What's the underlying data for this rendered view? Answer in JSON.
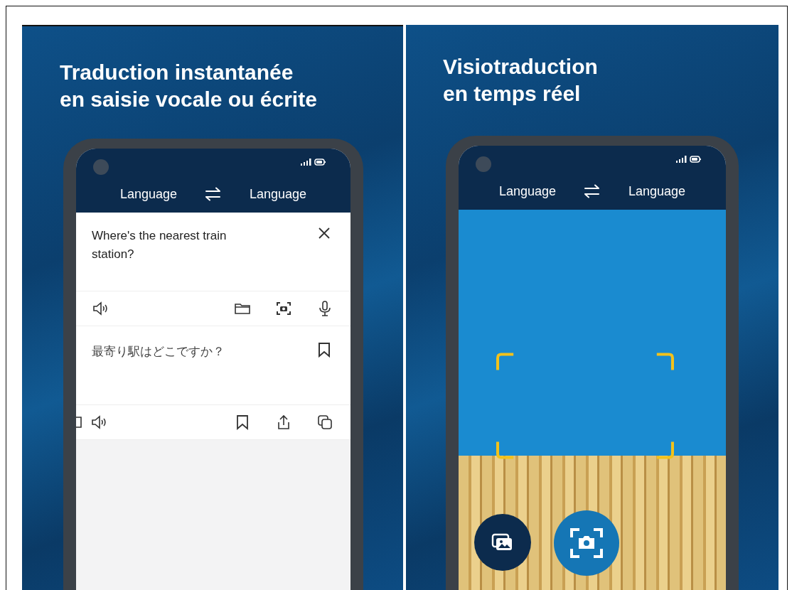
{
  "panels": [
    {
      "kind": "text",
      "headline_lines": [
        "Traduction instantanée",
        "en saisie vocale ou écrite"
      ],
      "phone": {
        "source_language": "Language",
        "target_language": "Language",
        "input_text": "Where's the nearest train station?",
        "output_text": "最寄り駅はどこですか？"
      }
    },
    {
      "kind": "camera",
      "headline_lines": [
        "Visiotraduction",
        "en temps réel"
      ],
      "phone": {
        "source_language": "Language",
        "target_language": "Language"
      }
    }
  ]
}
